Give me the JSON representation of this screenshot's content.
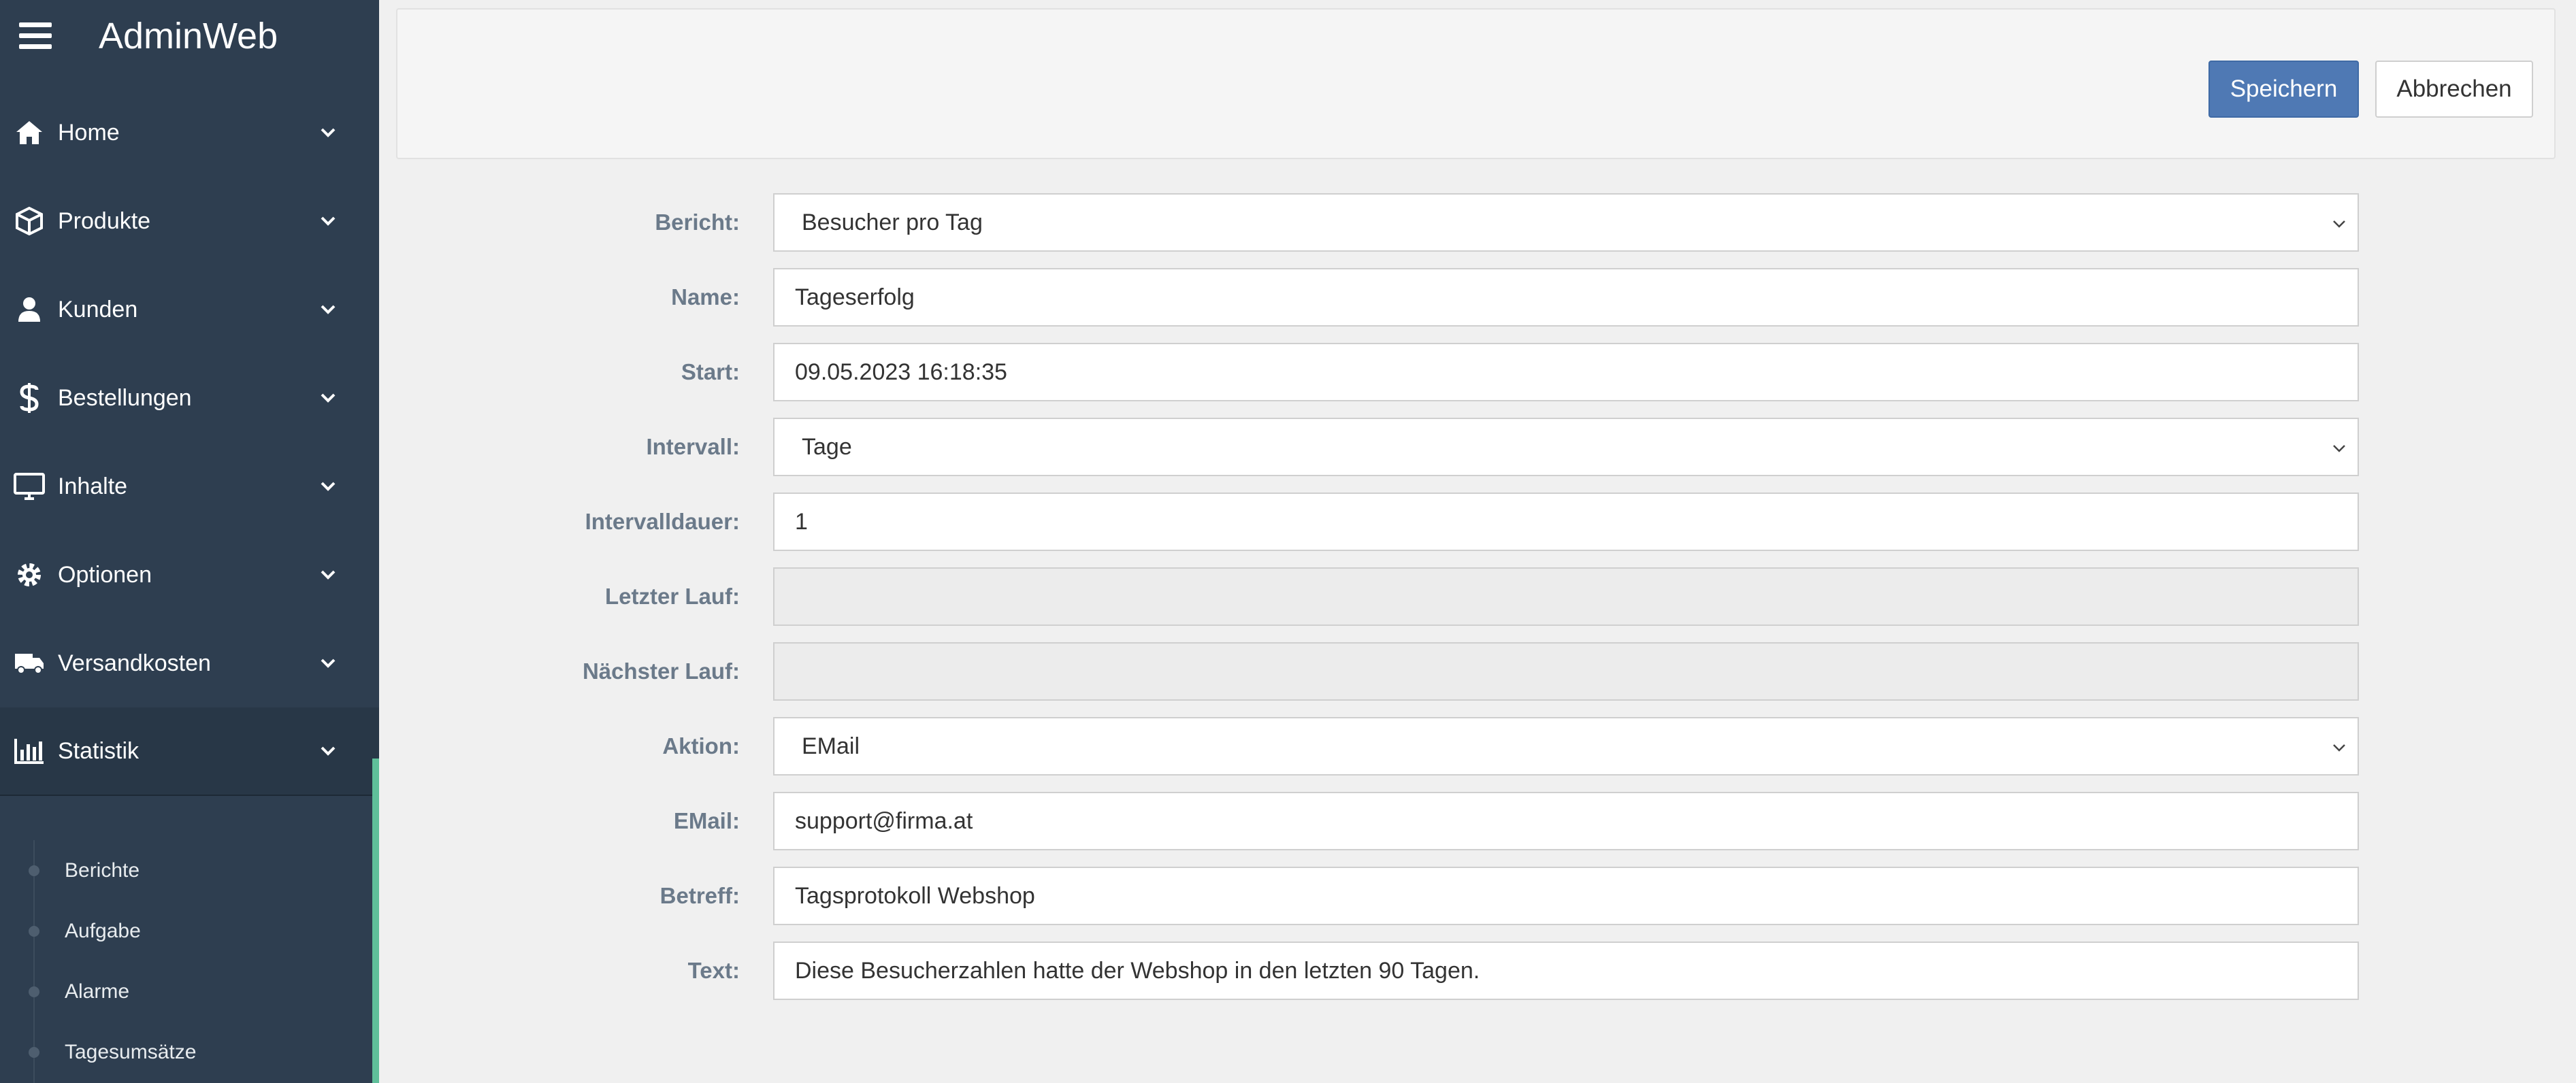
{
  "app": {
    "title": "AdminWeb"
  },
  "sidebar": {
    "items": [
      {
        "label": "Home",
        "icon": "home-icon"
      },
      {
        "label": "Produkte",
        "icon": "box-icon"
      },
      {
        "label": "Kunden",
        "icon": "user-icon"
      },
      {
        "label": "Bestellungen",
        "icon": "dollar-icon"
      },
      {
        "label": "Inhalte",
        "icon": "monitor-icon"
      },
      {
        "label": "Optionen",
        "icon": "gear-icon"
      },
      {
        "label": "Versandkosten",
        "icon": "truck-icon"
      },
      {
        "label": "Statistik",
        "icon": "bar-chart-icon"
      }
    ],
    "subitems": [
      "Berichte",
      "Aufgabe",
      "Alarme",
      "Tagesumsätze"
    ],
    "accent_color": "#5fbf9a"
  },
  "toolbar": {
    "save_label": "Speichern",
    "cancel_label": "Abbrechen"
  },
  "form": {
    "bericht": {
      "label": "Bericht:",
      "value": "Besucher pro Tag"
    },
    "name": {
      "label": "Name:",
      "value": "Tageserfolg"
    },
    "start": {
      "label": "Start:",
      "value": "09.05.2023 16:18:35"
    },
    "intervall": {
      "label": "Intervall:",
      "value": "Tage"
    },
    "intervalldauer": {
      "label": "Intervalldauer:",
      "value": "1"
    },
    "letzter_lauf": {
      "label": "Letzter Lauf:",
      "value": ""
    },
    "naechster_lauf": {
      "label": "Nächster Lauf:",
      "value": ""
    },
    "aktion": {
      "label": "Aktion:",
      "value": "EMail"
    },
    "email": {
      "label": "EMail:",
      "value": "support@firma.at"
    },
    "betreff": {
      "label": "Betreff:",
      "value": "Tagsprotokoll Webshop"
    },
    "text": {
      "label": "Text:",
      "value": "Diese Besucherzahlen hatte der Webshop in den letzten 90 Tagen."
    }
  },
  "colors": {
    "sidebar_bg": "#2e3e50",
    "primary_button": "#4f79b4"
  }
}
